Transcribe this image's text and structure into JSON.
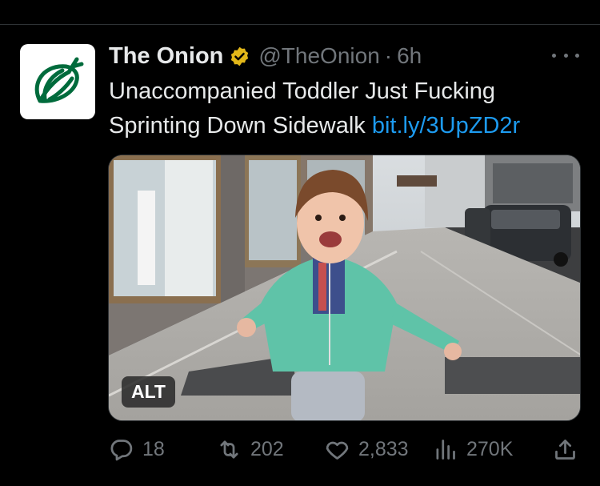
{
  "tweet": {
    "display_name": "The Onion",
    "handle": "@TheOnion",
    "separator": "·",
    "time": "6h",
    "text": "Unaccompanied Toddler Just Fucking Sprinting Down Sidewalk",
    "link": "bit.ly/3UpZD2r",
    "media": {
      "alt_badge": "ALT"
    },
    "stats": {
      "replies": "18",
      "reposts": "202",
      "likes": "2,833",
      "views": "270K"
    }
  },
  "colors": {
    "background": "#000000",
    "text": "#e7e9ea",
    "secondary": "#71767b",
    "link": "#1d9bf0",
    "verified_gold": "#e2b719",
    "onion_green": "#006b3c"
  },
  "icons": [
    "onion-logo-icon",
    "verified-badge-icon",
    "more-icon",
    "reply-icon",
    "repost-icon",
    "like-icon",
    "views-icon",
    "share-icon"
  ]
}
